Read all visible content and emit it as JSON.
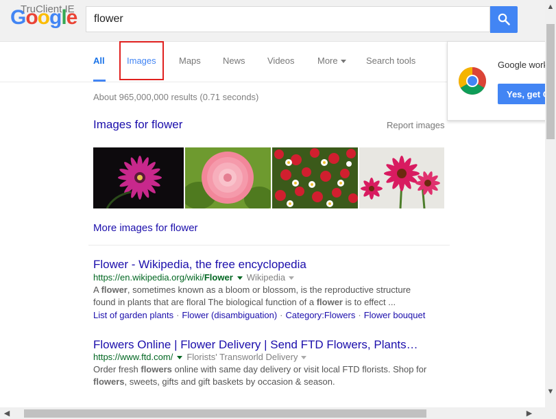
{
  "header": {
    "watermark": "TruClient IE",
    "logo_letters": [
      {
        "char": "G",
        "color": "#4285f4"
      },
      {
        "char": "o",
        "color": "#ea4335"
      },
      {
        "char": "o",
        "color": "#fbbc05"
      },
      {
        "char": "g",
        "color": "#4285f4"
      },
      {
        "char": "l",
        "color": "#34a853"
      },
      {
        "char": "e",
        "color": "#ea4335"
      }
    ],
    "search_query": "flower",
    "search_button_icon": "search-icon"
  },
  "tabs": {
    "all": "All",
    "images": "Images",
    "maps": "Maps",
    "news": "News",
    "videos": "Videos",
    "more": "More",
    "search_tools": "Search tools"
  },
  "result_stats": "About 965,000,000 results (0.71 seconds)",
  "images_section": {
    "heading": "Images for flower",
    "report_link": "Report images",
    "more_link": "More images for flower"
  },
  "results": [
    {
      "title": "Flower - Wikipedia, the free encyclopedia",
      "url_prefix": "https://en.wikipedia.org/wiki/",
      "url_bold": "Flower",
      "source": "Wikipedia",
      "snippet_line1_a": "A ",
      "snippet_line1_b": "flower",
      "snippet_line1_c": ", sometimes known as a bloom or blossom, is the reproductive structure",
      "snippet_line2_a": "found in plants that are floral The biological function of a ",
      "snippet_line2_b": "flower",
      "snippet_line2_c": " is to effect ...",
      "sitelinks": [
        "List of garden plants",
        "Flower (disambiguation)",
        "Category:Flowers",
        "Flower bouquet"
      ],
      "separator": "·"
    },
    {
      "title": "Flowers Online | Flower Delivery | Send FTD Flowers, Plants…",
      "url": "https://www.ftd.com/",
      "source": "Florists' Transworld Delivery",
      "snippet_line1_a": "Order fresh ",
      "snippet_line1_b": "flowers",
      "snippet_line1_c": " online with same day delivery or visit local FTD florists. Shop for",
      "snippet_line2_a": "flowers",
      "snippet_line2_b": ", sweets, gifts and gift baskets by occasion & season."
    }
  ],
  "promo": {
    "text": "Google works",
    "button": "Yes, get Chrome"
  },
  "scrollbars": {
    "up_arrow": "▲",
    "down_arrow": "▼",
    "left_arrow": "◀",
    "right_arrow": "▶"
  }
}
